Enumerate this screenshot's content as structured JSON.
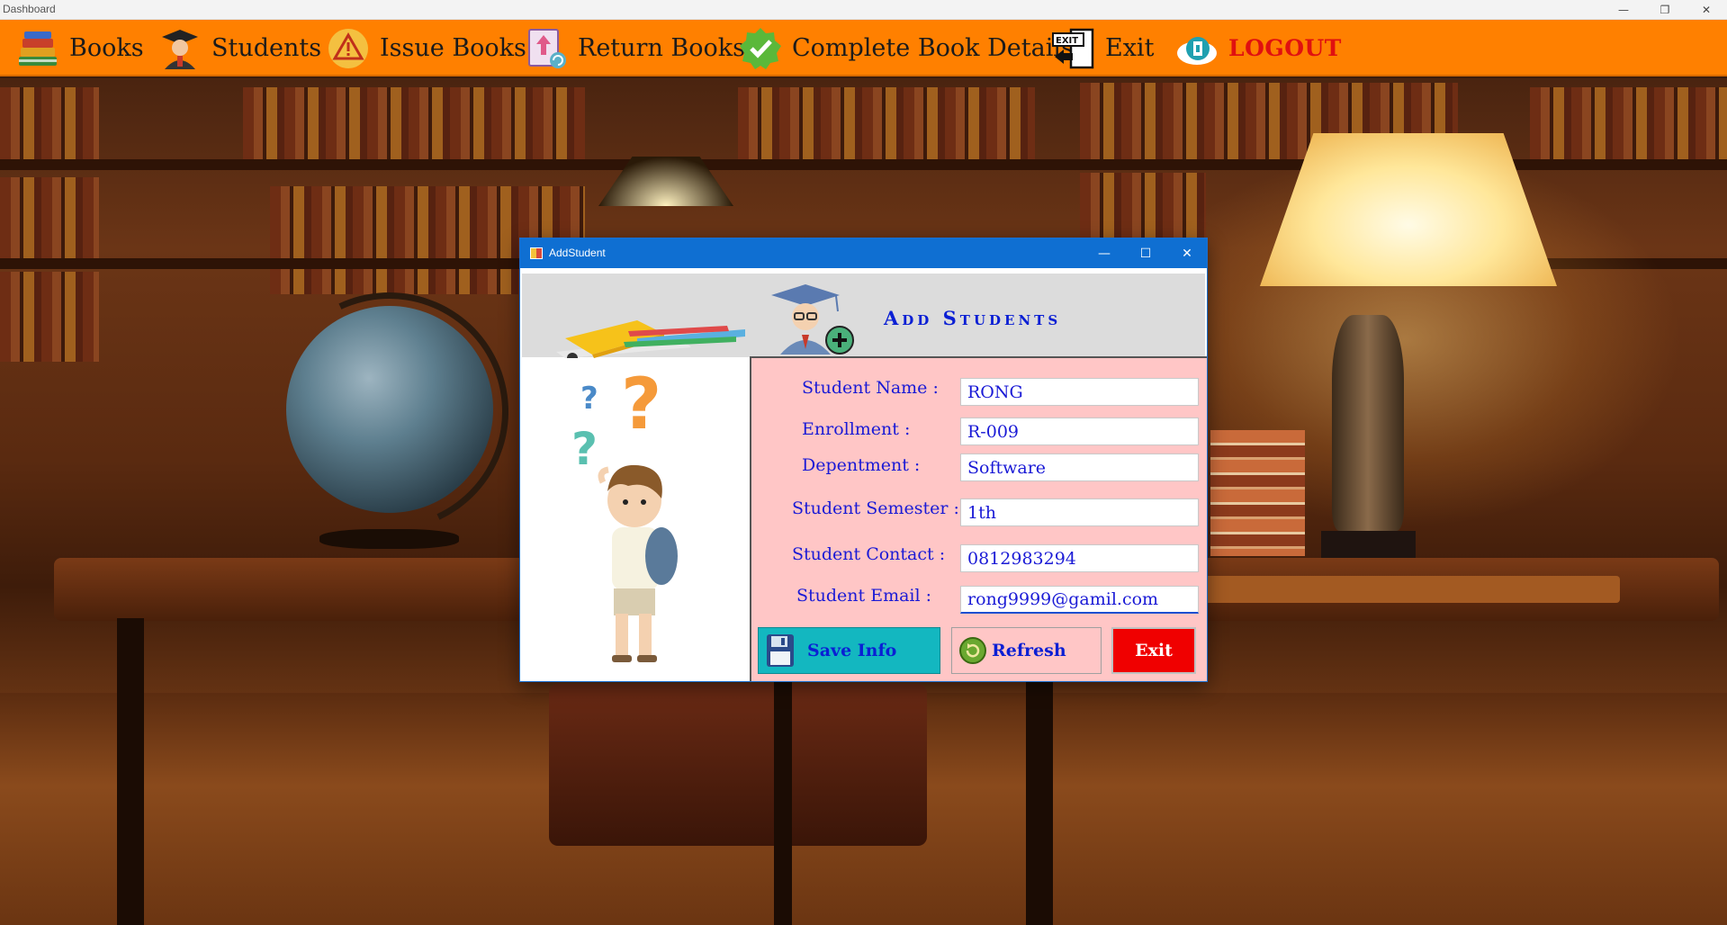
{
  "window": {
    "title": "Dashboard",
    "controls": {
      "minimize": "—",
      "restore": "❐",
      "close": "✕"
    }
  },
  "menu": {
    "items": [
      {
        "label": "Books",
        "icon": "books-stack-icon"
      },
      {
        "label": "Students",
        "icon": "graduate-student-icon"
      },
      {
        "label": "Issue Books",
        "icon": "warning-triangle-icon"
      },
      {
        "label": "Return Books",
        "icon": "return-book-icon"
      },
      {
        "label": "Complete Book Details",
        "icon": "checkmark-badge-icon"
      },
      {
        "label": "Exit",
        "icon": "exit-door-icon"
      },
      {
        "label": "LOGOUT",
        "icon": "logout-icon"
      }
    ],
    "background_color": "#ff8000"
  },
  "dialog": {
    "title": "AddStudent",
    "header_title": "Add Students",
    "controls": {
      "minimize": "—",
      "maximize": "☐",
      "close": "✕"
    },
    "form": {
      "student_name": {
        "label": "Student Name :",
        "value": "RONG"
      },
      "enrollment": {
        "label": "Enrollment :",
        "value": "R-009"
      },
      "department": {
        "label": "Depentment :",
        "value": "Software"
      },
      "semester": {
        "label": "Student Semester :",
        "value": "1th"
      },
      "contact": {
        "label": "Student Contact :",
        "value": "0812983294"
      },
      "email": {
        "label": "Student Email :",
        "value": "rong9999@gamil.com"
      }
    },
    "buttons": {
      "save": "Save Info",
      "refresh": "Refresh",
      "exit": "Exit"
    },
    "colors": {
      "titlebar": "#0f6fd2",
      "form_bg": "#ffc6c6",
      "label_text": "#1a1ad6",
      "save_bg": "#13b7c0",
      "exit_bg": "#f00000"
    }
  }
}
